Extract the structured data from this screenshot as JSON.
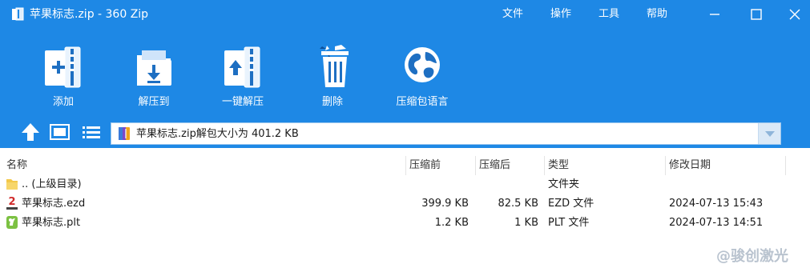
{
  "window": {
    "title": "苹果标志.zip - 360 Zip",
    "menu": [
      "文件",
      "操作",
      "工具",
      "帮助"
    ]
  },
  "toolbar": {
    "buttons": [
      {
        "label": "添加",
        "icon": "add-icon"
      },
      {
        "label": "解压到",
        "icon": "extract-to-icon"
      },
      {
        "label": "一键解压",
        "icon": "one-click-extract-icon"
      },
      {
        "label": "删除",
        "icon": "trash-icon"
      },
      {
        "label": "压缩包语言",
        "icon": "globe-icon"
      }
    ]
  },
  "navbar": {
    "path_text": "苹果标志.zip解包大小为 401.2 KB"
  },
  "file_list": {
    "columns": [
      "名称",
      "压缩前",
      "压缩后",
      "类型",
      "修改日期"
    ],
    "rows": [
      {
        "name": ".. (上级目录)",
        "original": "",
        "compressed": "",
        "type": "文件夹",
        "modified": "",
        "icon": "folder-icon"
      },
      {
        "name": "苹果标志.ezd",
        "original": "399.9 KB",
        "compressed": "82.5 KB",
        "type": "EZD 文件",
        "modified": "2024-07-13 15:43",
        "icon": "ezcad-file-icon"
      },
      {
        "name": "苹果标志.plt",
        "original": "1.2 KB",
        "compressed": "1 KB",
        "type": "PLT 文件",
        "modified": "2024-07-13 14:51",
        "icon": "plt-file-icon"
      }
    ]
  },
  "watermark": "@骏创激光",
  "colors": {
    "accent": "#1e88e5",
    "watermark": "#b9c3cf"
  }
}
